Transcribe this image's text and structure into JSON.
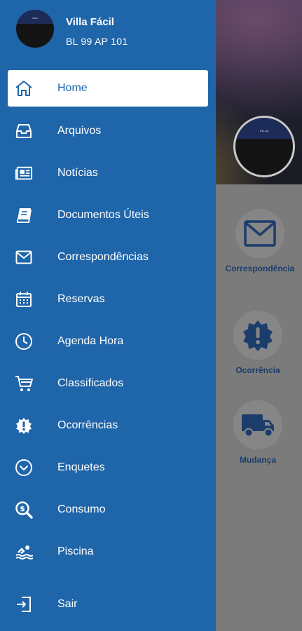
{
  "colors": {
    "drawer": "#1f65a9",
    "active_bg": "#ffffff",
    "active_text": "#1f65a9",
    "text": "#ffffff",
    "tile_label": "#1c3d6c"
  },
  "profile": {
    "name": "Villa Fácil",
    "unit": "BL 99 AP 101"
  },
  "menu": [
    {
      "label": "Home",
      "icon": "home-icon",
      "active": true
    },
    {
      "label": "Arquivos",
      "icon": "inbox-icon"
    },
    {
      "label": "Notícias",
      "icon": "newspaper-icon"
    },
    {
      "label": "Documentos Úteis",
      "icon": "book-icon"
    },
    {
      "label": "Correspondências",
      "icon": "envelope-icon"
    },
    {
      "label": "Reservas",
      "icon": "calendar-icon"
    },
    {
      "label": "Agenda Hora",
      "icon": "clock-icon"
    },
    {
      "label": "Classificados",
      "icon": "cart-icon"
    },
    {
      "label": "Ocorrências",
      "icon": "alert-badge-icon"
    },
    {
      "label": "Enquetes",
      "icon": "chevron-circle-icon"
    },
    {
      "label": "Consumo",
      "icon": "search-dollar-icon"
    },
    {
      "label": "Piscina",
      "icon": "swimmer-icon"
    },
    {
      "label": "Sair",
      "icon": "sign-out-icon"
    }
  ],
  "background_tiles": [
    {
      "label": "Correspondência",
      "icon": "envelope-icon"
    },
    {
      "label": "Ocorrência",
      "icon": "alert-badge-icon"
    },
    {
      "label": "Mudança",
      "icon": "truck-icon"
    }
  ]
}
